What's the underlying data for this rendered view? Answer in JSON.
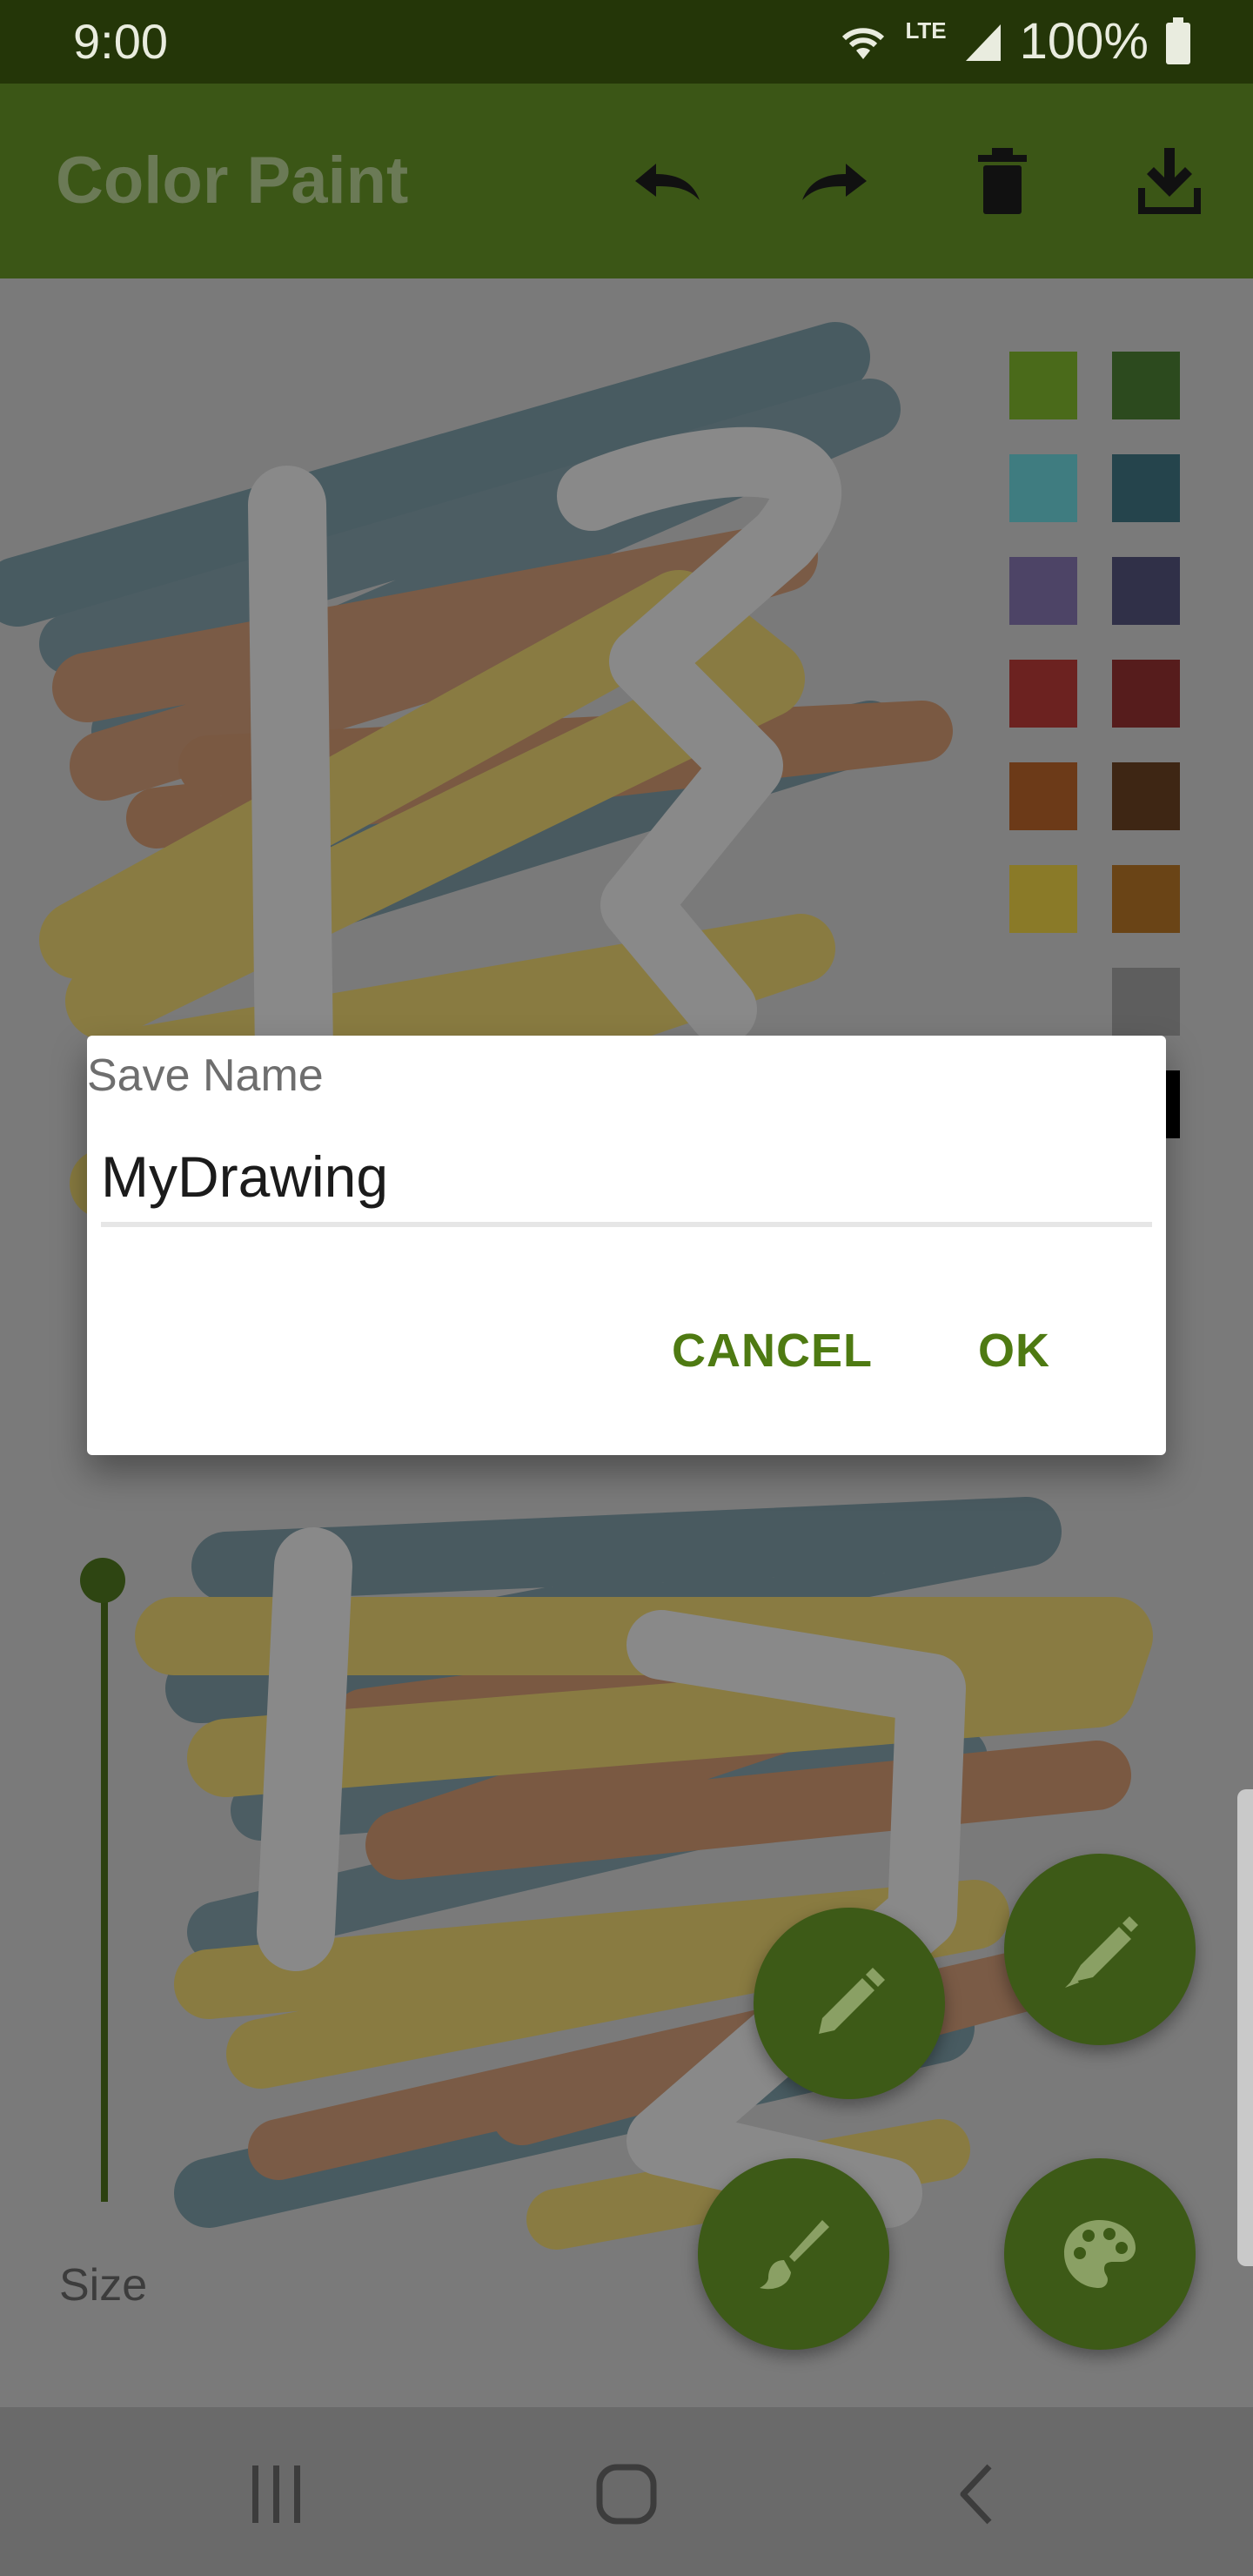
{
  "status_bar": {
    "time": "9:00",
    "network": "LTE",
    "battery": "100%",
    "icons": [
      "wifi-icon",
      "signal-icon",
      "battery-icon"
    ]
  },
  "app_bar": {
    "title": "Color Paint",
    "actions": [
      "undo-icon",
      "redo-icon",
      "delete-icon",
      "download-icon"
    ]
  },
  "palette": {
    "colors": [
      "#4a6a1a",
      "#2c4a1e",
      "#3f7c80",
      "#25444c",
      "#4d4466",
      "#303048",
      "#6c2220",
      "#561c1c",
      "#6c3a18",
      "#3e2614",
      "#8a7a28",
      "#6a4416",
      "#5e5e5e",
      "#000000"
    ]
  },
  "size_control": {
    "label": "Size",
    "value": 0.0
  },
  "fabs": [
    "pencil-icon",
    "marker-icon",
    "brush-icon",
    "palette-icon"
  ],
  "dialog": {
    "title": "Save Name",
    "input_value": "MyDrawing",
    "cancel_label": "CANCEL",
    "ok_label": "OK"
  },
  "nav_bar": [
    "recent-apps-icon",
    "home-icon",
    "back-icon"
  ],
  "colors": {
    "accent": "#4e7a12",
    "app_bar": "#3b5616",
    "status_bar": "#243608"
  }
}
